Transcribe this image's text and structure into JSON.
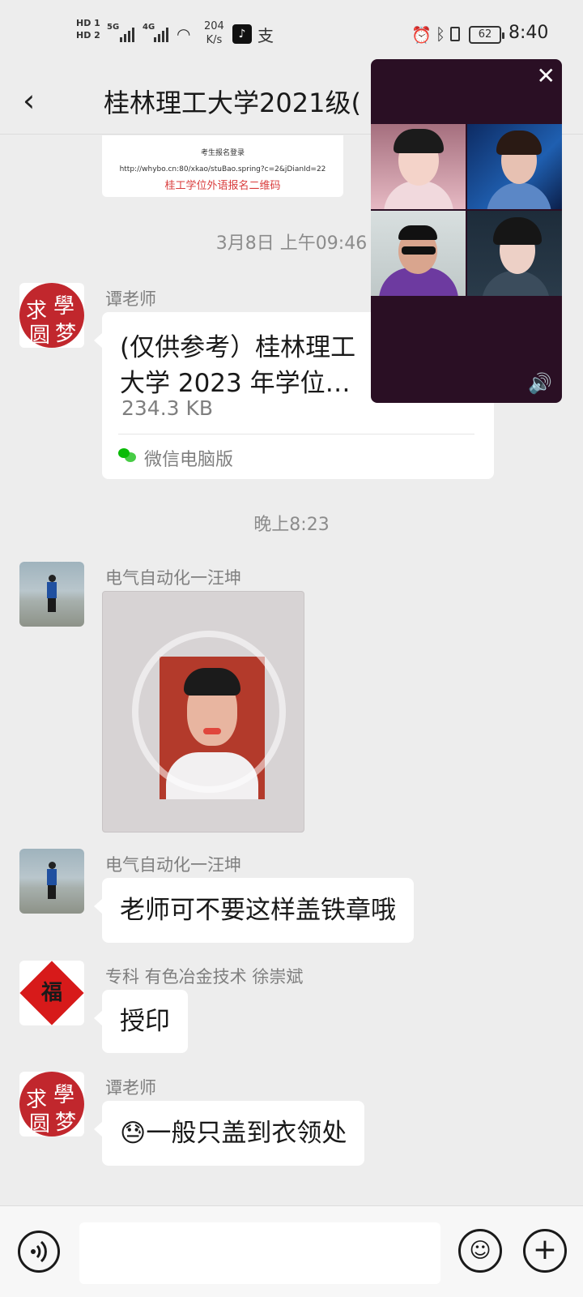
{
  "status_bar": {
    "hd1": "HD 1",
    "hd2": "HD 2",
    "sig1_label": "5G",
    "sig2_label": "4G",
    "speed_value": "204",
    "speed_unit": "K/s",
    "battery": "62",
    "time": "8:40"
  },
  "header": {
    "title": "桂林理工大学2021级("
  },
  "qr_card": {
    "heading": "考生报名登录",
    "url": "http://whybo.cn:80/xkao/stuBao.spring?c=2&jDianId=22",
    "caption": "桂工学位外语报名二维码"
  },
  "timestamps": [
    "3月8日 上午09:46",
    "晚上8:23"
  ],
  "messages": [
    {
      "sender": "谭老师",
      "avatar": "seal-avatar",
      "seal_chars": [
        "學",
        "求",
        "圆",
        "梦"
      ],
      "type": "file",
      "file_name": "(仅供参考）桂林理工大学 2023 年学位…",
      "file_size": "234.3 KB",
      "file_source": "微信电脑版"
    },
    {
      "sender": "电气自动化一汪坤",
      "avatar": "beach-avatar",
      "type": "image"
    },
    {
      "sender": "电气自动化一汪坤",
      "avatar": "beach-avatar",
      "type": "text",
      "text": "老师可不要这样盖铁章哦"
    },
    {
      "sender": "专科 有色冶金技术 徐崇斌",
      "avatar": "fu-avatar",
      "fu_char": "福",
      "type": "text",
      "text": "授印"
    },
    {
      "sender": "谭老师",
      "avatar": "seal-avatar",
      "type": "text",
      "emoji": "😓",
      "text": "一般只盖到衣领处"
    }
  ],
  "video_window": {
    "close_icon": "✕",
    "sound_icon": "🔊"
  },
  "input_bar": {
    "voice_icon": "voice-icon",
    "emoji_icon": "☺",
    "plus_icon": "+"
  }
}
